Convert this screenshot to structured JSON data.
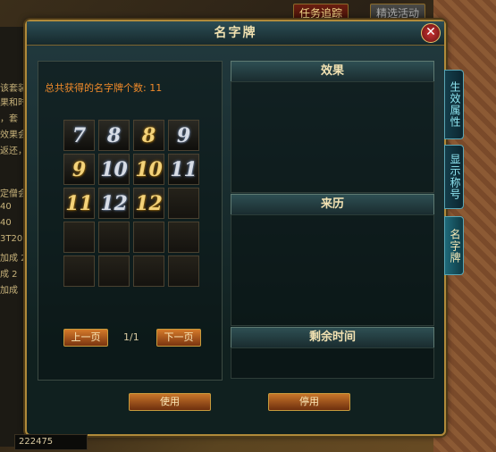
{
  "topbar": {
    "quest_track": "任务追踪",
    "quest_select": "精选活动"
  },
  "panel": {
    "title": "名字牌",
    "close": "✕"
  },
  "summary": {
    "total_label": "总共获得的名字牌个数: 11"
  },
  "nameplates": [
    {
      "text": "7",
      "style": "silver"
    },
    {
      "text": "8",
      "style": "silver"
    },
    {
      "text": "8",
      "style": "gold"
    },
    {
      "text": "9",
      "style": "silver"
    },
    {
      "text": "9",
      "style": "gold"
    },
    {
      "text": "10",
      "style": "silver"
    },
    {
      "text": "10",
      "style": "gold"
    },
    {
      "text": "11",
      "style": "silver"
    },
    {
      "text": "11",
      "style": "gold"
    },
    {
      "text": "12",
      "style": "silver"
    },
    {
      "text": "12",
      "style": "gold"
    },
    {
      "text": "",
      "style": "empty"
    },
    {
      "text": "",
      "style": "empty"
    },
    {
      "text": "",
      "style": "empty"
    },
    {
      "text": "",
      "style": "empty"
    },
    {
      "text": "",
      "style": "empty"
    },
    {
      "text": "",
      "style": "empty"
    },
    {
      "text": "",
      "style": "empty"
    },
    {
      "text": "",
      "style": "empty"
    },
    {
      "text": "",
      "style": "empty"
    }
  ],
  "pager": {
    "prev": "上一页",
    "page": "1/1",
    "next": "下一页"
  },
  "sections": {
    "effect": "效果",
    "source": "来历",
    "remaining": "剩余时间"
  },
  "side_tabs": [
    {
      "label": "生效属性",
      "active": false
    },
    {
      "label": "显示称号",
      "active": false
    },
    {
      "label": "名字牌",
      "active": true
    }
  ],
  "actions": {
    "use": "使用",
    "disable": "停用"
  },
  "background": {
    "left_lines": [
      "该套装",
      "果和时",
      "，套",
      "效果会",
      "返还，",
      "定僧会套装",
      "40",
      "40",
      "3T20",
      "加成 2",
      "成 2",
      "加成"
    ],
    "footer_value": "222475"
  }
}
